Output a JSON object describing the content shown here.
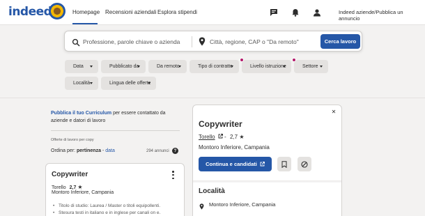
{
  "header": {
    "logo_text": "indeed",
    "nav": [
      "Homepage",
      "Recensioni aziendali",
      "Esplora stipendi"
    ],
    "employers_link": "Indeed aziende/Pubblica un annuncio",
    "icons": [
      "chat-icon",
      "bell-icon",
      "person-icon"
    ]
  },
  "search": {
    "what_placeholder": "Professione, parole chiave o azienda",
    "where_placeholder": "Città, regione, CAP o \"Da remoto\"",
    "button_label": "Cerca lavoro"
  },
  "filters": [
    {
      "label": "Data",
      "dot": false
    },
    {
      "label": "Pubblicato da",
      "dot": false
    },
    {
      "label": "Da remoto",
      "dot": false
    },
    {
      "label": "Tipo di contratto",
      "dot": false
    },
    {
      "label": "Livello istruzione",
      "dot": true
    },
    {
      "label": "Settore",
      "dot": true
    },
    {
      "label": "Località",
      "dot": false
    },
    {
      "label": "Lingua delle offerte",
      "dot": false
    }
  ],
  "left": {
    "cv_link": "Pubblica il tuo Curriculum",
    "cv_text": " per essere contattato da aziende e datori di lavoro",
    "offers_note": "Offerte di lavoro per copy",
    "sort_prefix": "Ordina per: ",
    "sort_current": "pertinenza",
    "sort_sep": " - ",
    "sort_alt": "data",
    "count": "294 annunci",
    "help": "?"
  },
  "job_card": {
    "title": "Copywriter",
    "company": "Torello",
    "rating": "2,7",
    "location": "Montoro Inferiore, Campania",
    "bullets": [
      "Titolo di studio: Laurea / Master o titoli equipollenti.",
      "Stesura testi in italiano e in inglese per canali on e."
    ]
  },
  "detail": {
    "title": "Copywriter",
    "company": "Torello",
    "rating": "2,7",
    "location": "Montoro Inferiore, Campania",
    "apply_label": "Continua e candidati",
    "section_title": "Località",
    "section_location": "Montoro Inferiore, Campania"
  },
  "colors": {
    "brand_blue": "#2557a7",
    "dot_magenta": "#b3196a",
    "filter_bg": "#e4e2e0"
  }
}
